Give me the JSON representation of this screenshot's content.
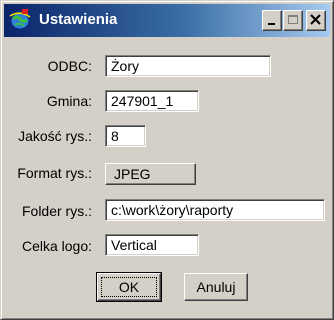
{
  "window": {
    "title": "Ustawienia",
    "titlebar_colors": {
      "start": "#0a246a",
      "end": "#a6caf0"
    },
    "app_icon": "globe-icon",
    "controls": [
      "minimize-icon",
      "maximize-icon",
      "close-icon"
    ]
  },
  "form": {
    "odbc": {
      "label": "ODBC:",
      "value": "Żory"
    },
    "gmina": {
      "label": "Gmina:",
      "value": "247901_1"
    },
    "jakosc": {
      "label": "Jakość rys.:",
      "value": "8"
    },
    "format": {
      "label": "Format rys.:",
      "value": "JPEG"
    },
    "folder": {
      "label": "Folder rys.:",
      "value": "c:\\work\\żory\\raporty"
    },
    "celka": {
      "label": "Celka logo:",
      "value": "Vertical"
    }
  },
  "buttons": {
    "ok_label": "OK",
    "cancel_label": "Anuluj"
  }
}
